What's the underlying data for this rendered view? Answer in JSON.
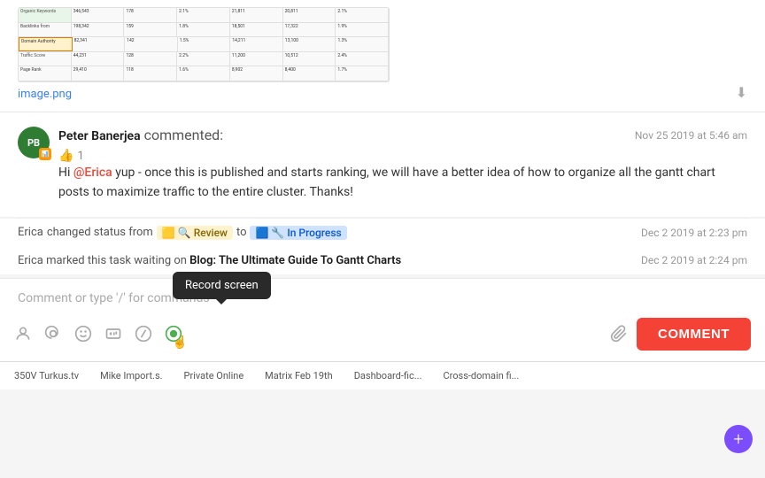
{
  "image": {
    "filename": "image.png",
    "download_label": "⬇"
  },
  "comment": {
    "author_initials": "PB",
    "author_name": "Peter Banerjea",
    "author_badge": "📊",
    "action": "commented:",
    "time": "Nov 25 2019 at 5:46 am",
    "mention": "@Erica",
    "body_text": " yup - once this is published and starts ranking, we will have a better idea of how to organize all the gantt chart posts to maximize traffic to the entire cluster. Thanks!",
    "like_count": "1"
  },
  "status_change": {
    "actor": "Erica",
    "action": "changed status from",
    "from_status": "Review",
    "to_word": "to",
    "to_status": "In Progress",
    "time": "Dec 2 2019 at 2:23 pm"
  },
  "waiting_change": {
    "actor": "Erica",
    "action": "marked this task waiting on",
    "link_text": "Blog: The Ultimate Guide To Gantt Charts",
    "time": "Dec 2 2019 at 2:24 pm"
  },
  "comment_input": {
    "placeholder": "Comment or type '/' for commands"
  },
  "toolbar": {
    "record_screen_tooltip": "Record screen",
    "comment_button_label": "COMMENT",
    "icons": {
      "person": "👤",
      "at": "@",
      "emoji_face": "🙂",
      "smiley": "😊",
      "slash": "/",
      "record": "⏺",
      "attachment": "📎"
    }
  },
  "bottom_tabs": [
    {
      "label": "350V Turkus.tv",
      "active": false
    },
    {
      "label": "Mike Import.s.",
      "active": false
    },
    {
      "label": "Private Online",
      "active": false
    },
    {
      "label": "Matrix Feb 19th",
      "active": false
    },
    {
      "label": "Dashboard-fic...",
      "active": false
    },
    {
      "label": "Cross-domain fi...",
      "active": false
    }
  ],
  "float_button": {
    "label": "+"
  }
}
